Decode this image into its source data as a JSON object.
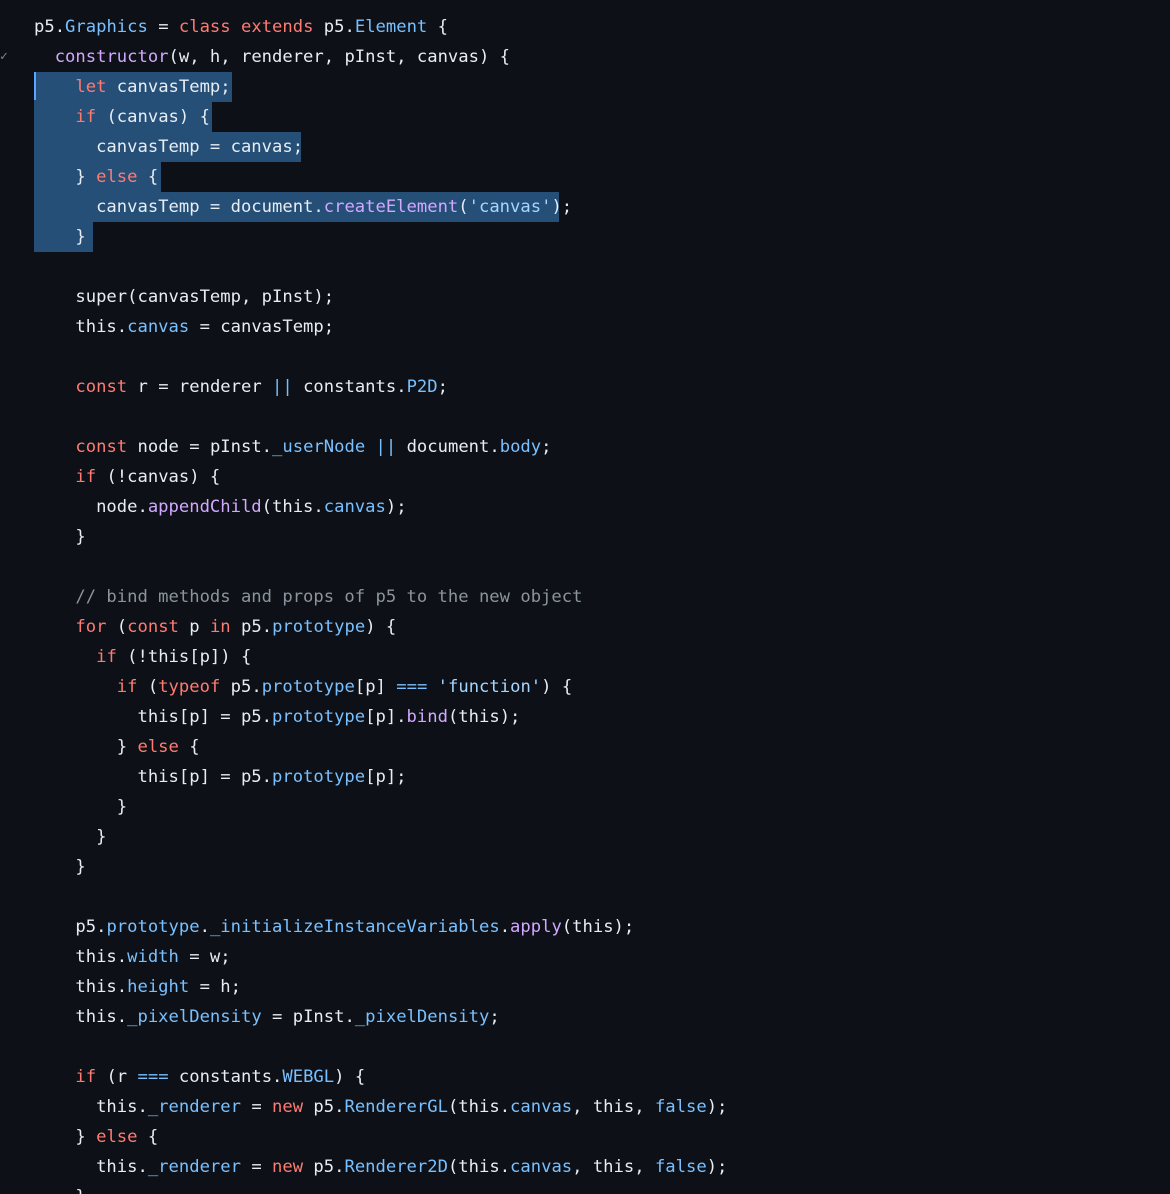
{
  "gutter": {
    "fold_marker": "✓"
  },
  "code_lines": [
    [
      {
        "c": "pl",
        "t": "p5."
      },
      {
        "c": "ent",
        "t": "Graphics"
      },
      {
        "c": "pl",
        "t": " = "
      },
      {
        "c": "kw",
        "t": "class"
      },
      {
        "c": "pl",
        "t": " "
      },
      {
        "c": "kw",
        "t": "extends"
      },
      {
        "c": "pl",
        "t": " p5."
      },
      {
        "c": "ent",
        "t": "Element"
      },
      {
        "c": "pl",
        "t": " {"
      }
    ],
    [
      {
        "c": "pl",
        "t": "  "
      },
      {
        "c": "fn",
        "t": "constructor"
      },
      {
        "c": "pl",
        "t": "(w, h, renderer, pInst, canvas) {"
      }
    ],
    [
      {
        "c": "pl",
        "t": "    "
      },
      {
        "c": "kw",
        "t": "let"
      },
      {
        "c": "pl",
        "t": " canvasTemp;"
      }
    ],
    [
      {
        "c": "pl",
        "t": "    "
      },
      {
        "c": "kw",
        "t": "if"
      },
      {
        "c": "pl",
        "t": " (canvas) {"
      }
    ],
    [
      {
        "c": "pl",
        "t": "      canvasTemp = canvas;"
      }
    ],
    [
      {
        "c": "pl",
        "t": "    } "
      },
      {
        "c": "kw",
        "t": "else"
      },
      {
        "c": "pl",
        "t": " {"
      }
    ],
    [
      {
        "c": "pl",
        "t": "      canvasTemp = document."
      },
      {
        "c": "fn",
        "t": "createElement"
      },
      {
        "c": "pl",
        "t": "("
      },
      {
        "c": "str",
        "t": "'canvas'"
      },
      {
        "c": "pl",
        "t": ");"
      }
    ],
    [
      {
        "c": "pl",
        "t": "    }"
      }
    ],
    [],
    [
      {
        "c": "pl",
        "t": "    super(canvasTemp, pInst);"
      }
    ],
    [
      {
        "c": "pl",
        "t": "    this."
      },
      {
        "c": "ent",
        "t": "canvas"
      },
      {
        "c": "pl",
        "t": " = canvasTemp;"
      }
    ],
    [],
    [
      {
        "c": "pl",
        "t": "    "
      },
      {
        "c": "kw",
        "t": "const"
      },
      {
        "c": "pl",
        "t": " r = renderer "
      },
      {
        "c": "ent",
        "t": "||"
      },
      {
        "c": "pl",
        "t": " constants."
      },
      {
        "c": "ent",
        "t": "P2D"
      },
      {
        "c": "pl",
        "t": ";"
      }
    ],
    [],
    [
      {
        "c": "pl",
        "t": "    "
      },
      {
        "c": "kw",
        "t": "const"
      },
      {
        "c": "pl",
        "t": " node = pInst."
      },
      {
        "c": "ent",
        "t": "_userNode"
      },
      {
        "c": "pl",
        "t": " "
      },
      {
        "c": "ent",
        "t": "||"
      },
      {
        "c": "pl",
        "t": " document."
      },
      {
        "c": "ent",
        "t": "body"
      },
      {
        "c": "pl",
        "t": ";"
      }
    ],
    [
      {
        "c": "pl",
        "t": "    "
      },
      {
        "c": "kw",
        "t": "if"
      },
      {
        "c": "pl",
        "t": " (!canvas) {"
      }
    ],
    [
      {
        "c": "pl",
        "t": "      node."
      },
      {
        "c": "fn",
        "t": "appendChild"
      },
      {
        "c": "pl",
        "t": "(this."
      },
      {
        "c": "ent",
        "t": "canvas"
      },
      {
        "c": "pl",
        "t": ");"
      }
    ],
    [
      {
        "c": "pl",
        "t": "    }"
      }
    ],
    [],
    [
      {
        "c": "cm",
        "t": "    // bind methods and props of p5 to the new object"
      }
    ],
    [
      {
        "c": "pl",
        "t": "    "
      },
      {
        "c": "kw",
        "t": "for"
      },
      {
        "c": "pl",
        "t": " ("
      },
      {
        "c": "kw",
        "t": "const"
      },
      {
        "c": "pl",
        "t": " p "
      },
      {
        "c": "kw",
        "t": "in"
      },
      {
        "c": "pl",
        "t": " p5."
      },
      {
        "c": "ent",
        "t": "prototype"
      },
      {
        "c": "pl",
        "t": ") {"
      }
    ],
    [
      {
        "c": "pl",
        "t": "      "
      },
      {
        "c": "kw",
        "t": "if"
      },
      {
        "c": "pl",
        "t": " (!this[p]) {"
      }
    ],
    [
      {
        "c": "pl",
        "t": "        "
      },
      {
        "c": "kw",
        "t": "if"
      },
      {
        "c": "pl",
        "t": " ("
      },
      {
        "c": "kw",
        "t": "typeof"
      },
      {
        "c": "pl",
        "t": " p5."
      },
      {
        "c": "ent",
        "t": "prototype"
      },
      {
        "c": "pl",
        "t": "[p] "
      },
      {
        "c": "ent",
        "t": "==="
      },
      {
        "c": "pl",
        "t": " "
      },
      {
        "c": "str",
        "t": "'function'"
      },
      {
        "c": "pl",
        "t": ") {"
      }
    ],
    [
      {
        "c": "pl",
        "t": "          this[p] = p5."
      },
      {
        "c": "ent",
        "t": "prototype"
      },
      {
        "c": "pl",
        "t": "[p]."
      },
      {
        "c": "fn",
        "t": "bind"
      },
      {
        "c": "pl",
        "t": "(this);"
      }
    ],
    [
      {
        "c": "pl",
        "t": "        } "
      },
      {
        "c": "kw",
        "t": "else"
      },
      {
        "c": "pl",
        "t": " {"
      }
    ],
    [
      {
        "c": "pl",
        "t": "          this[p] = p5."
      },
      {
        "c": "ent",
        "t": "prototype"
      },
      {
        "c": "pl",
        "t": "[p];"
      }
    ],
    [
      {
        "c": "pl",
        "t": "        }"
      }
    ],
    [
      {
        "c": "pl",
        "t": "      }"
      }
    ],
    [
      {
        "c": "pl",
        "t": "    }"
      }
    ],
    [],
    [
      {
        "c": "pl",
        "t": "    p5."
      },
      {
        "c": "ent",
        "t": "prototype"
      },
      {
        "c": "pl",
        "t": "."
      },
      {
        "c": "ent",
        "t": "_initializeInstanceVariables"
      },
      {
        "c": "pl",
        "t": "."
      },
      {
        "c": "fn",
        "t": "apply"
      },
      {
        "c": "pl",
        "t": "(this);"
      }
    ],
    [
      {
        "c": "pl",
        "t": "    this."
      },
      {
        "c": "ent",
        "t": "width"
      },
      {
        "c": "pl",
        "t": " = w;"
      }
    ],
    [
      {
        "c": "pl",
        "t": "    this."
      },
      {
        "c": "ent",
        "t": "height"
      },
      {
        "c": "pl",
        "t": " = h;"
      }
    ],
    [
      {
        "c": "pl",
        "t": "    this."
      },
      {
        "c": "ent",
        "t": "_pixelDensity"
      },
      {
        "c": "pl",
        "t": " = pInst."
      },
      {
        "c": "ent",
        "t": "_pixelDensity"
      },
      {
        "c": "pl",
        "t": ";"
      }
    ],
    [],
    [
      {
        "c": "pl",
        "t": "    "
      },
      {
        "c": "kw",
        "t": "if"
      },
      {
        "c": "pl",
        "t": " (r "
      },
      {
        "c": "ent",
        "t": "==="
      },
      {
        "c": "pl",
        "t": " constants."
      },
      {
        "c": "ent",
        "t": "WEBGL"
      },
      {
        "c": "pl",
        "t": ") {"
      }
    ],
    [
      {
        "c": "pl",
        "t": "      this."
      },
      {
        "c": "ent",
        "t": "_renderer"
      },
      {
        "c": "pl",
        "t": " = "
      },
      {
        "c": "kw",
        "t": "new"
      },
      {
        "c": "pl",
        "t": " p5."
      },
      {
        "c": "ent",
        "t": "RendererGL"
      },
      {
        "c": "pl",
        "t": "(this."
      },
      {
        "c": "ent",
        "t": "canvas"
      },
      {
        "c": "pl",
        "t": ", this, "
      },
      {
        "c": "ent",
        "t": "false"
      },
      {
        "c": "pl",
        "t": ");"
      }
    ],
    [
      {
        "c": "pl",
        "t": "    } "
      },
      {
        "c": "kw",
        "t": "else"
      },
      {
        "c": "pl",
        "t": " {"
      }
    ],
    [
      {
        "c": "pl",
        "t": "      this."
      },
      {
        "c": "ent",
        "t": "_renderer"
      },
      {
        "c": "pl",
        "t": " = "
      },
      {
        "c": "kw",
        "t": "new"
      },
      {
        "c": "pl",
        "t": " p5."
      },
      {
        "c": "ent",
        "t": "Renderer2D"
      },
      {
        "c": "pl",
        "t": "(this."
      },
      {
        "c": "ent",
        "t": "canvas"
      },
      {
        "c": "pl",
        "t": ", this, "
      },
      {
        "c": "ent",
        "t": "false"
      },
      {
        "c": "pl",
        "t": ");"
      }
    ],
    [
      {
        "c": "pl",
        "t": "    }"
      }
    ]
  ]
}
